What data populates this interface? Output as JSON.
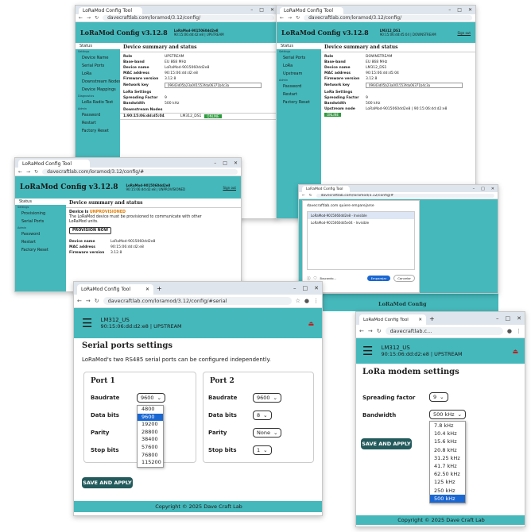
{
  "browser": {
    "tab_title": "LoRaMod Config Tool",
    "url_w1": "davecraftlab.com/loramod/3.12/config/",
    "url_w2": "davecraftlab.com/loramod/3.12/config/",
    "url_w3": "davecraftlab.com/loramod/3.12/config/#",
    "url_w5": "davecraftlab.com/loramod/3.12/config/#serial",
    "url_w6": "davecraftlab.c...",
    "url_popup": "davecraftlab.com/loramod/3.12/config/#"
  },
  "app": {
    "brand": "LoRaMod Config v3.12.8",
    "brand_short": "LoRaMod Config",
    "sign_out": "Sign out",
    "footer": "Copyright © 2025 Dave Craft Lab"
  },
  "w1": {
    "device_id": "LoRaMod-9015060dd2e8",
    "device_sub": "90:15:06:dd:d2:e8 | UPSTREAM",
    "sidebar": [
      "Status",
      "Settings",
      "Device Name",
      "Serial Ports",
      "LoRa",
      "Downstream Nodes",
      "Device Mappings",
      "Diagnostics",
      "LoRa Radio Test",
      "Admin",
      "Password",
      "Restart",
      "Factory Reset"
    ],
    "title": "Device summary and status",
    "rows": [
      {
        "k": "Role",
        "v": "UPSTREAM"
      },
      {
        "k": "Base-band",
        "v": "EU 868 MHz"
      },
      {
        "k": "Device name",
        "v": "LoRaMod-9015060dd2e8"
      },
      {
        "k": "MAC address",
        "v": "90:15:06:dd:d2:e8"
      },
      {
        "k": "Firmware version",
        "v": "3.12.8"
      }
    ],
    "network_key_label": "Network key",
    "network_key": "09643d05b23a001553fda06371b4c3a",
    "lora_settings": "LoRa Settings",
    "lora_rows": [
      {
        "k": "Spreading Factor",
        "v": "9"
      },
      {
        "k": "Bandwidth",
        "v": "500 kHz"
      }
    ],
    "downstream_title": "Downstream Nodes",
    "node_mac": "1:90:15:06:dd:d5:04",
    "node_name": "LM312_DS1",
    "node_status": "ONLINE"
  },
  "w2": {
    "device_id": "LM312_DS1",
    "device_sub": "90:15:06:dd:d5:04 | DOWNSTREAM",
    "sidebar": [
      "Status",
      "Settings",
      "Serial Ports",
      "LoRa",
      "Upstream",
      "Admin",
      "Password",
      "Restart",
      "Factory Reset"
    ],
    "title": "Device summary and status",
    "rows": [
      {
        "k": "Role",
        "v": "DOWNSTREAM"
      },
      {
        "k": "Base-band",
        "v": "EU 868 MHz"
      },
      {
        "k": "Device name",
        "v": "LM312_DS1"
      },
      {
        "k": "MAC address",
        "v": "90:15:06:dd:d5:04"
      },
      {
        "k": "Firmware version",
        "v": "3.12.8"
      }
    ],
    "network_key_label": "Network key",
    "network_key": "09643d05b23a001553fda06371b4c3a",
    "lora_settings": "LoRa Settings",
    "lora_rows": [
      {
        "k": "Spreading Factor",
        "v": "9"
      },
      {
        "k": "Bandwidth",
        "v": "500 kHz"
      }
    ],
    "upstream_label": "Upstream node",
    "upstream_value": "LoRaMod-9015060dd2e8 | 90:15:06:dd:d2:e8",
    "upstream_status": "ONLINE"
  },
  "w3": {
    "device_id": "LoRaMod-9015060dd2e8",
    "device_sub": "90:15:06:dd:d2:e8 | UNPROVISIONED",
    "sidebar": [
      "Status",
      "Settings",
      "Provisioning",
      "Serial Ports",
      "Admin",
      "Password",
      "Restart",
      "Factory Reset"
    ],
    "title": "Device summary and status",
    "unprov_prefix": "Device is",
    "unprov_status": "UNPROVISIONED",
    "unprov_text": "The LoRaMod device must be provisioned to communicate with other LoRaMod units.",
    "provision_button": "PROVISION NOW",
    "rows": [
      {
        "k": "Device name",
        "v": "LoRaMod-9015060dd2e8"
      },
      {
        "k": "MAC address",
        "v": "90:15:06:dd:d2:e8"
      },
      {
        "k": "Firmware version",
        "v": "3.12.8"
      }
    ]
  },
  "popup": {
    "title": "davecraftlab.com quiere emparejarse",
    "devices": [
      "LoRaMod-9015060dd2e8 - Invisible",
      "LoRaMod-9015060dd5e04 - Invisible"
    ],
    "searching": "Buscando...",
    "pair_button": "Emparejar",
    "cancel_button": "Cancelar",
    "under_title": "LoRaMod Config"
  },
  "w5": {
    "device_id": "LM312_US",
    "device_sub": "90:15:06:dd:d2:e8 | UPSTREAM",
    "title": "Serial ports settings",
    "desc": "LoRaMod's two RS485 serial ports can be configured independently.",
    "port1": {
      "title": "Port 1",
      "labels": [
        "Baudrate",
        "Data bits",
        "Parity",
        "Stop bits"
      ],
      "baud": "9600"
    },
    "port2": {
      "title": "Port 2",
      "labels": [
        "Baudrate",
        "Data bits",
        "Parity",
        "Stop bits"
      ],
      "baud": "9600",
      "data": "8",
      "parity": "None",
      "stop": "1"
    },
    "baud_options": [
      "4800",
      "9600",
      "19200",
      "28800",
      "38400",
      "57600",
      "76800",
      "115200"
    ],
    "baud_selected": "9600",
    "save_button": "SAVE AND APPLY"
  },
  "w6": {
    "device_id": "LM312_US",
    "device_sub": "90:15:06:dd:d2:e8 | UPSTREAM",
    "title": "LoRa modem settings",
    "sf_label": "Spreading factor",
    "sf_value": "9",
    "bw_label": "Bandwidth",
    "bw_value": "500 kHz",
    "bw_options": [
      "7.8 kHz",
      "10.4 kHz",
      "15.6 kHz",
      "20.8 kHz",
      "31.25 kHz",
      "41.7 kHz",
      "62.50 kHz",
      "125 kHz",
      "250 kHz",
      "500 kHz"
    ],
    "bw_selected": "500 kHz",
    "save_button": "SAVE AND APPLY"
  },
  "colors": {
    "teal": "#45b8bb",
    "dark_button": "#235a5c",
    "online": "#2e9a3e",
    "unprovisioned": "#e07b00",
    "select_blue": "#1a67d2"
  }
}
